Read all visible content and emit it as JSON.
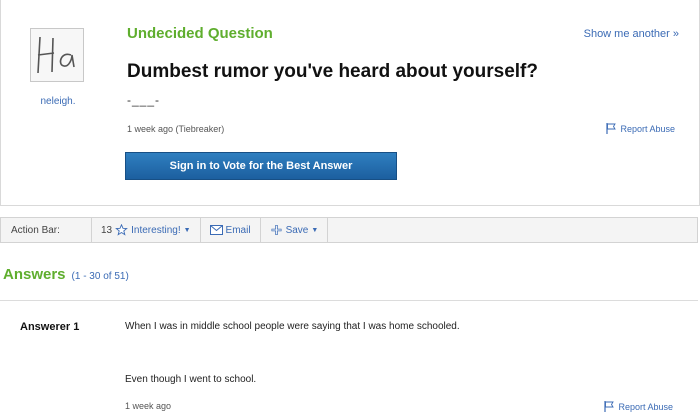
{
  "question": {
    "status": "Undecided Question",
    "show_another": "Show me another »",
    "title": "Dumbest rumor you've heard about yourself?",
    "details": "-___-",
    "meta": "1 week ago (Tiebreaker)",
    "report_abuse": "Report Abuse",
    "vote_button": "Sign in to Vote for the Best Answer"
  },
  "asker": {
    "avatar_text": "Ha",
    "username": "neleigh."
  },
  "action_bar": {
    "label": "Action Bar:",
    "interesting_count": "13",
    "interesting_label": "Interesting!",
    "email_label": "Email",
    "save_label": "Save"
  },
  "answers": {
    "title": "Answers",
    "count_text": "(1 - 30 of 51)",
    "items": [
      {
        "answerer": "Answerer 1",
        "line1": "When I was in middle school people were saying that I was home schooled.",
        "line2": "Even though I went to school.",
        "meta": "1 week ago",
        "report_abuse": "Report Abuse"
      }
    ]
  },
  "colors": {
    "status_green": "#5fae2e",
    "link_blue": "#3b6bb5",
    "button_blue": "#1c5f9f"
  }
}
